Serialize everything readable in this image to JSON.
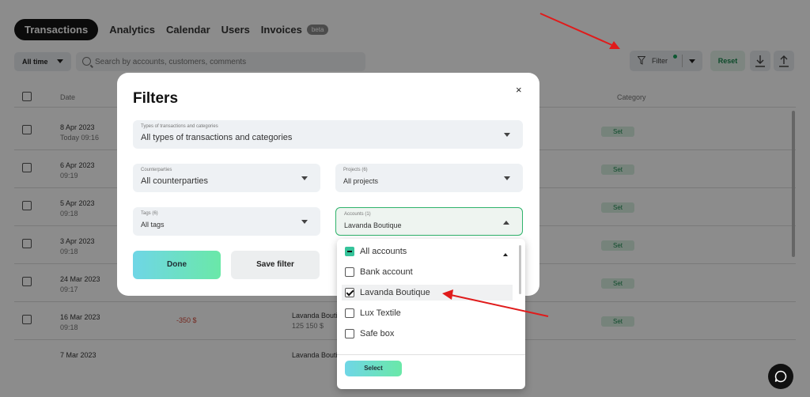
{
  "nav": {
    "tabs": [
      {
        "label": "Transactions"
      },
      {
        "label": "Analytics"
      },
      {
        "label": "Calendar"
      },
      {
        "label": "Users"
      },
      {
        "label": "Invoices"
      }
    ],
    "beta_badge": "beta"
  },
  "toolbar": {
    "period_label": "All time",
    "search_placeholder": "Search by accounts, customers, comments",
    "filter_label": "Filter",
    "reset_label": "Reset"
  },
  "table": {
    "headers": {
      "date": "Date",
      "category": "Category"
    },
    "rows": [
      {
        "date": "8 Apr 2023",
        "time": "Today 09:16",
        "amount": "",
        "account": "",
        "sub": "",
        "tag": "Set"
      },
      {
        "date": "6 Apr 2023",
        "time": "09:19",
        "amount": "",
        "account": "",
        "sub": "",
        "tag": "Set"
      },
      {
        "date": "5 Apr 2023",
        "time": "09:18",
        "amount": "",
        "account": "",
        "sub": "",
        "tag": "Set"
      },
      {
        "date": "3 Apr 2023",
        "time": "09:18",
        "amount": "",
        "account": "",
        "sub": "",
        "tag": "Set"
      },
      {
        "date": "24 Mar 2023",
        "time": "09:17",
        "amount": "",
        "account": "",
        "sub": "",
        "tag": "Set"
      },
      {
        "date": "16 Mar 2023",
        "time": "09:18",
        "amount": "-350 $",
        "account": "Lavanda Bouti",
        "sub": "125 150 $",
        "tag": "Set"
      },
      {
        "date": "7 Mar 2023",
        "time": "",
        "amount": "",
        "account": "Lavanda Bouti",
        "sub": "",
        "tag": ""
      }
    ]
  },
  "modal": {
    "title": "Filters",
    "close": "×",
    "types": {
      "label": "Types of transactions and categories",
      "value": "All types of transactions and categories"
    },
    "counterparties": {
      "label": "Counterparties",
      "value": "All counterparties"
    },
    "projects": {
      "label": "Projects (6)",
      "value": "All projects"
    },
    "tags": {
      "label": "Tags (6)",
      "value": "All tags"
    },
    "accounts": {
      "label": "Accounts (1)",
      "value": "Lavanda Boutique"
    },
    "done_label": "Done",
    "save_label": "Save filter"
  },
  "dropdown": {
    "options": [
      {
        "label": "All accounts",
        "state": "partial"
      },
      {
        "label": "Bank account",
        "state": "unchecked"
      },
      {
        "label": "Lavanda Boutique",
        "state": "checked"
      },
      {
        "label": "Lux Textile",
        "state": "unchecked"
      },
      {
        "label": "Safe box",
        "state": "unchecked"
      }
    ],
    "select_label": "Select"
  },
  "colors": {
    "accent_green": "#2fb36b",
    "annotation_arrow": "#e01b1b",
    "negative_amount": "#d34a3a"
  }
}
